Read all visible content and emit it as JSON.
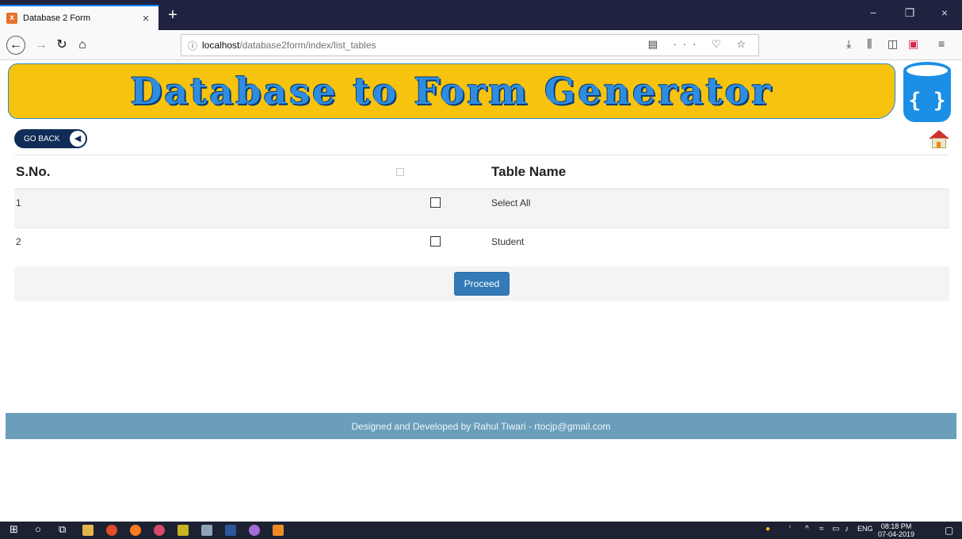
{
  "browser": {
    "tab_title": "Database 2 Form",
    "tab_favicon": "xampp-icon",
    "new_tab_symbol": "+",
    "close_tab_symbol": "×",
    "url_info_symbol": "ⓘ",
    "url_host": "localhost",
    "url_path": "/database2form/index/list_tables",
    "url_actions": "▤ ··· ♡ ☆",
    "window_controls": [
      "−",
      "❐",
      "×"
    ]
  },
  "banner": {
    "title": "Database to Form Generator",
    "db_icon_text": "{ }"
  },
  "toolbar": {
    "go_back_label": "GO BACK",
    "go_back_arrow": "◀"
  },
  "table": {
    "headers": {
      "sno": "S.No.",
      "table_name": "Table Name"
    },
    "rows": [
      {
        "sno": "1",
        "name": "Select All",
        "checked": false
      },
      {
        "sno": "2",
        "name": "Student",
        "checked": false
      }
    ]
  },
  "actions": {
    "proceed_label": "Proceed"
  },
  "footer": {
    "text": "Designed and Developed by Rahul Tiwari - rtocjp@gmail.com"
  },
  "taskbar": {
    "time": "08:18 PM",
    "date": "07-04-2019",
    "language": "ENG"
  },
  "colors": {
    "banner_bg": "#f7c30e",
    "banner_text": "#2f8de0",
    "go_back_bg": "#0f2d57",
    "proceed_bg": "#337ab7",
    "footer_bg": "#6a9ebb"
  }
}
